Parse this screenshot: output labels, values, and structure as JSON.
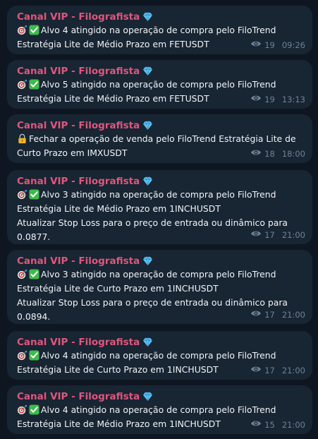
{
  "colors": {
    "background": "#0e1621",
    "bubble": "#182533",
    "sender": "#e0567d",
    "meta": "#6d8396"
  },
  "messages": [
    {
      "sender": "Canal VIP - Filografista",
      "icons": [
        "target-icon",
        "check-icon"
      ],
      "lines": [
        "Alvo 4 atingido na operação de compra pelo FiloTrend",
        "Estratégia Lite de Médio Prazo em FETUSDT"
      ],
      "views": "19",
      "time": "09:26"
    },
    {
      "sender": "Canal VIP - Filografista",
      "icons": [
        "target-icon",
        "check-icon"
      ],
      "lines": [
        "Alvo 5 atingido na operação de compra pelo FiloTrend",
        "Estratégia Lite de Médio Prazo em FETUSDT"
      ],
      "views": "19",
      "time": "13:13"
    },
    {
      "sender": "Canal VIP - Filografista",
      "icons": [
        "lock-icon"
      ],
      "lines": [
        "Fechar a operação de venda pelo FiloTrend Estratégia Lite de",
        "Curto Prazo em IMXUSDT"
      ],
      "views": "18",
      "time": "18:00"
    },
    {
      "sender": "Canal VIP - Filografista",
      "icons": [
        "target-icon",
        "check-icon"
      ],
      "lines": [
        "Alvo 3 atingido na operação de compra pelo FiloTrend",
        "Estratégia Lite de Médio Prazo em 1INCHUSDT",
        "Atualizar Stop Loss para o preço de entrada ou dinâmico para",
        "0.0877."
      ],
      "views": "17",
      "time": "21:00"
    },
    {
      "sender": "Canal VIP - Filografista",
      "icons": [
        "target-icon",
        "check-icon"
      ],
      "lines": [
        "Alvo 3 atingido na operação de compra pelo FiloTrend",
        "Estratégia Lite de Curto Prazo em 1INCHUSDT",
        "Atualizar Stop Loss para o preço de entrada ou dinâmico para",
        "0.0894."
      ],
      "views": "17",
      "time": "21:00"
    },
    {
      "sender": "Canal VIP - Filografista",
      "icons": [
        "target-icon",
        "check-icon"
      ],
      "lines": [
        "Alvo 4 atingido na operação de compra pelo FiloTrend",
        "Estratégia Lite de Curto Prazo em 1INCHUSDT"
      ],
      "views": "17",
      "time": "21:00"
    },
    {
      "sender": "Canal VIP - Filografista",
      "icons": [
        "target-icon",
        "check-icon"
      ],
      "lines": [
        "Alvo 4 atingido na operação de compra pelo FiloTrend",
        "Estratégia Lite de Médio Prazo em 1INCHUSDT"
      ],
      "views": "15",
      "time": "21:00"
    }
  ]
}
